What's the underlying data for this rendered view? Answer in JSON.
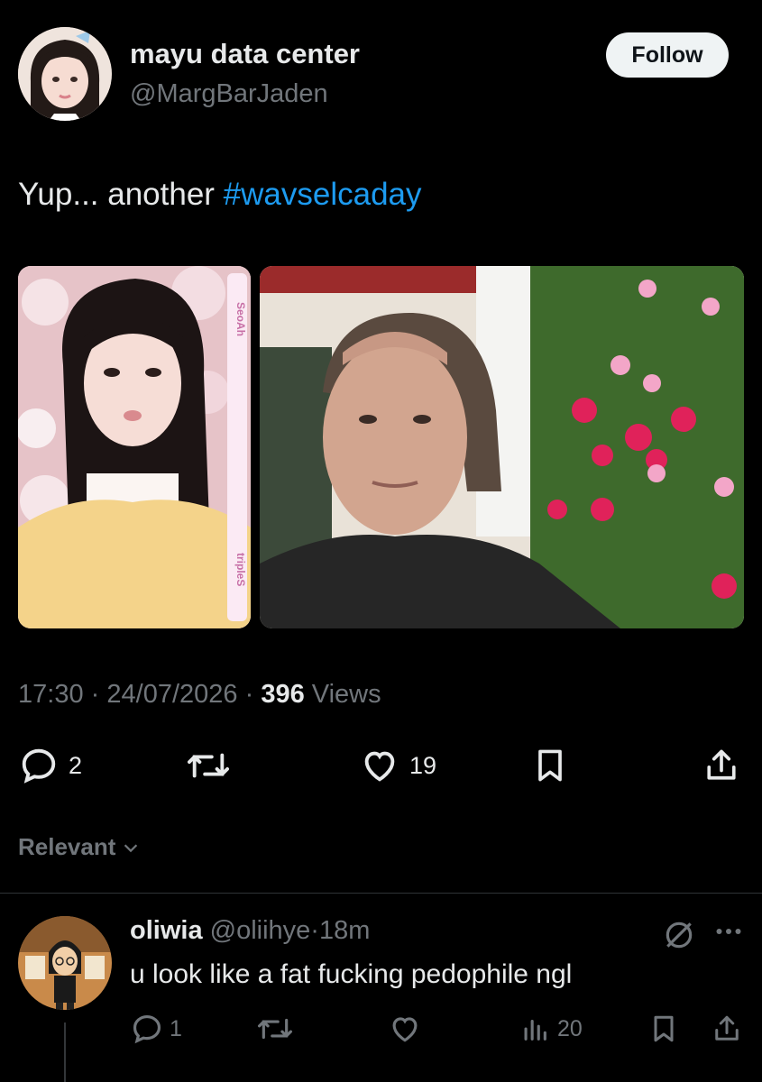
{
  "tweet": {
    "author_name": "mayu data center",
    "author_handle": "@MargBarJaden",
    "follow_label": "Follow",
    "text_prefix": "Yup... another ",
    "hashtag": "#wavselcaday",
    "photo1": {
      "side_label_top": "SeoAh",
      "side_label_bottom": "tripleS"
    },
    "time": "17:30",
    "date": "24/07/2026",
    "sep": "·",
    "views_count": "396",
    "views_label": "Views",
    "replies": "2",
    "likes": "19"
  },
  "filter": {
    "label": "Relevant"
  },
  "reply": {
    "author_name": "oliwia",
    "author_handle": "@oliihye",
    "sep": "·",
    "age": "18m",
    "text": "u look like a fat fucking pedophile ngl",
    "replies": "1",
    "views": "20"
  },
  "colors": {
    "accent": "#1d9bf0",
    "background": "#000000",
    "muted": "#71767b"
  }
}
